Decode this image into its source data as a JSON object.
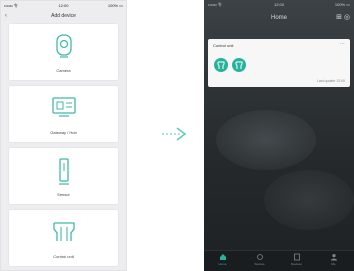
{
  "left_phone": {
    "status_bar": {
      "carrier": "•••oo 令",
      "time": "12:00",
      "battery": "100% ▭"
    },
    "nav": {
      "back": "‹",
      "title": "Add device"
    },
    "devices": [
      {
        "label": "Camera",
        "icon": "camera-icon"
      },
      {
        "label": "Gateway / Hub",
        "icon": "gateway-icon"
      },
      {
        "label": "Sensor",
        "icon": "sensor-icon"
      },
      {
        "label": "Control unit",
        "icon": "control-unit-icon"
      }
    ]
  },
  "arrow": {
    "icon": "arrow-right-icon"
  },
  "right_phone": {
    "status_bar": {
      "carrier": "•••oo 令",
      "time": "12:00",
      "battery": "100% ▭"
    },
    "header": {
      "title": "Home",
      "icons": "⊞ ◎"
    },
    "device_card": {
      "title": "Control unit",
      "more": "⋯",
      "footer": "Last update 12:00"
    },
    "tabs": [
      {
        "label": "Home",
        "icon": "home-icon",
        "active": true
      },
      {
        "label": "Scenes",
        "icon": "scenes-icon",
        "active": false
      },
      {
        "label": "Devices",
        "icon": "devices-icon",
        "active": false
      },
      {
        "label": "Me",
        "icon": "profile-icon",
        "active": false
      }
    ],
    "colors": {
      "accent": "#27b39a",
      "background": "#2f3437"
    }
  }
}
